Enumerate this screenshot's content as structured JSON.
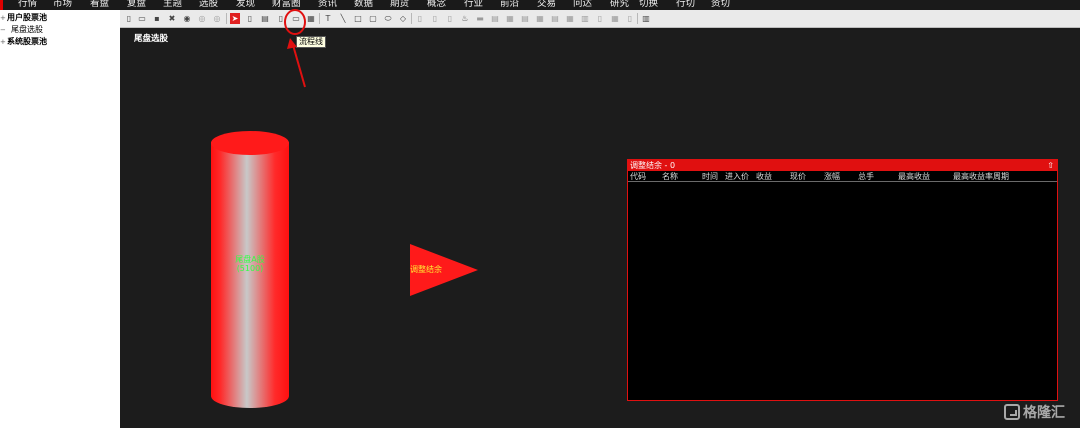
{
  "menu": [
    "行情",
    "市场",
    "看盘",
    "复盘",
    "主题",
    "选股",
    "发现",
    "财富圈",
    "资讯",
    "数据",
    "期货",
    "概念",
    "行业",
    "前沿",
    "交易",
    "问达",
    "研究",
    "切换",
    "行切",
    "资切"
  ],
  "tree": [
    {
      "label": "用户股票池",
      "expander": "+",
      "bold": true
    },
    {
      "label": "尾盘选股",
      "expander": "−",
      "bold": false
    },
    {
      "label": "系统股票池",
      "expander": "+",
      "bold": true
    }
  ],
  "canvas": {
    "title": "尾盘选股"
  },
  "tooltip": "流程线",
  "cylinder": {
    "label_line1": "尾盘A股",
    "label_line2": "(5100)"
  },
  "triangle": {
    "label": "调整结余"
  },
  "panel": {
    "title": "调整结余 - 0",
    "collapse_icon": "⇧",
    "columns": [
      "代码",
      "名称",
      "时间",
      "进入价",
      "收益",
      "现价",
      "涨幅",
      "总手",
      "最高收益",
      "最高收益率周期"
    ]
  },
  "watermark": {
    "text": "格隆汇"
  },
  "colors": {
    "accent_red": "#e01010",
    "cylinder_red": "#ff1a1a",
    "label_green": "#33ff44",
    "label_yellow": "#ffee33"
  },
  "icons": [
    "new-file-icon",
    "open-folder-icon",
    "save-icon",
    "delete-icon",
    "play-icon",
    "record-icon",
    "stop-icon",
    "pointer-icon",
    "page-icon",
    "grid-icon",
    "flowline-icon",
    "export-icon",
    "text-icon",
    "line-icon",
    "rect-icon",
    "rounded-rect-icon",
    "ellipse-icon",
    "diamond-icon",
    "align-icon",
    "chart-icon"
  ]
}
